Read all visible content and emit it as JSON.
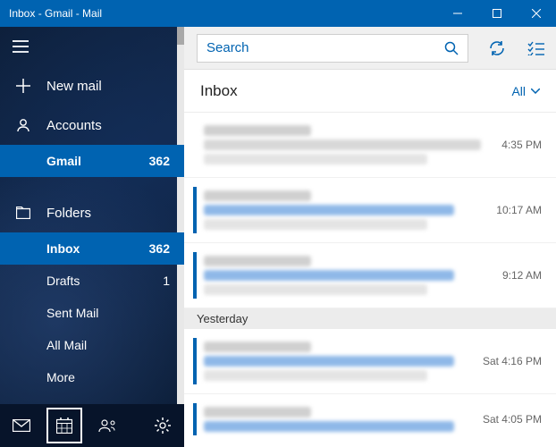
{
  "window": {
    "title": "Inbox - Gmail - Mail"
  },
  "sidebar": {
    "new_mail": "New mail",
    "accounts": "Accounts",
    "account": {
      "name": "Gmail",
      "count": "362"
    },
    "folders_label": "Folders",
    "folders": [
      {
        "label": "Inbox",
        "count": "362",
        "selected": true,
        "bold": true
      },
      {
        "label": "Drafts",
        "count": "1"
      },
      {
        "label": "Sent Mail",
        "count": ""
      },
      {
        "label": "All Mail",
        "count": ""
      },
      {
        "label": "More",
        "count": ""
      }
    ]
  },
  "search": {
    "placeholder": "Search"
  },
  "header": {
    "title": "Inbox",
    "filter": "All"
  },
  "sections": {
    "yesterday": "Yesterday"
  },
  "messages": [
    {
      "time": "4:35 PM",
      "unread": false
    },
    {
      "time": "10:17 AM",
      "unread": true
    },
    {
      "time": "9:12 AM",
      "unread": true
    },
    {
      "time": "Sat 4:16 PM",
      "unread": true,
      "section": "yesterday"
    },
    {
      "time": "Sat 4:05 PM",
      "unread": true
    }
  ]
}
